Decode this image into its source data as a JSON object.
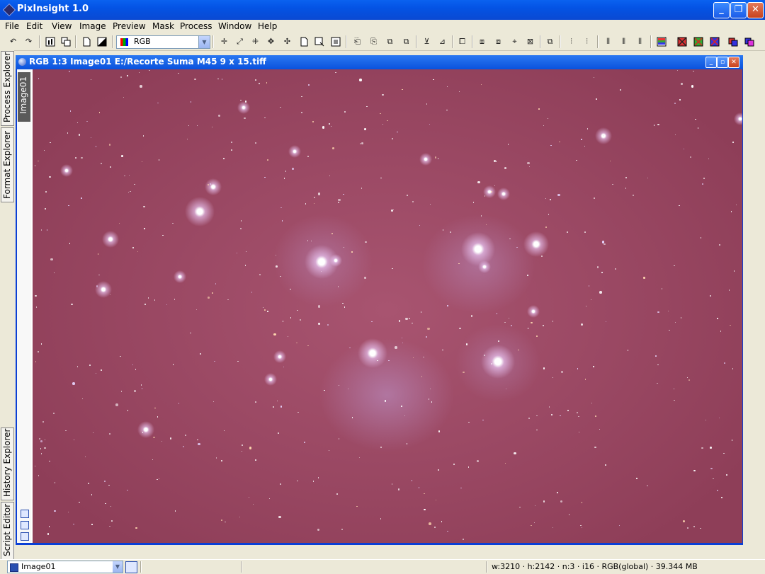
{
  "app": {
    "title": "PixInsight 1.0"
  },
  "window_buttons": {
    "minimize": "_",
    "maximize": "❐",
    "close": "✕"
  },
  "menu": [
    "File",
    "Edit",
    "View",
    "Image",
    "Preview",
    "Mask",
    "Process",
    "Window",
    "Help"
  ],
  "toolbar": {
    "color_mode": "RGB"
  },
  "left_dock": {
    "tabs": [
      "Process Explorer",
      "Format Explorer",
      "History Explorer",
      "Script Editor"
    ]
  },
  "document": {
    "title": "RGB 1:3 Image01 E:/Recorte Suma M45 9 x 15.tiff",
    "view_tab": "Image01"
  },
  "statusbar": {
    "view_selector": "Image01",
    "info": "w:3210 · h:2142 · n:3 · i16 · RGB(global) · 39.344 MB"
  },
  "colors": {
    "titlebar": "#0453e4",
    "sky": "#a05068",
    "chrome": "#ece9d8"
  }
}
